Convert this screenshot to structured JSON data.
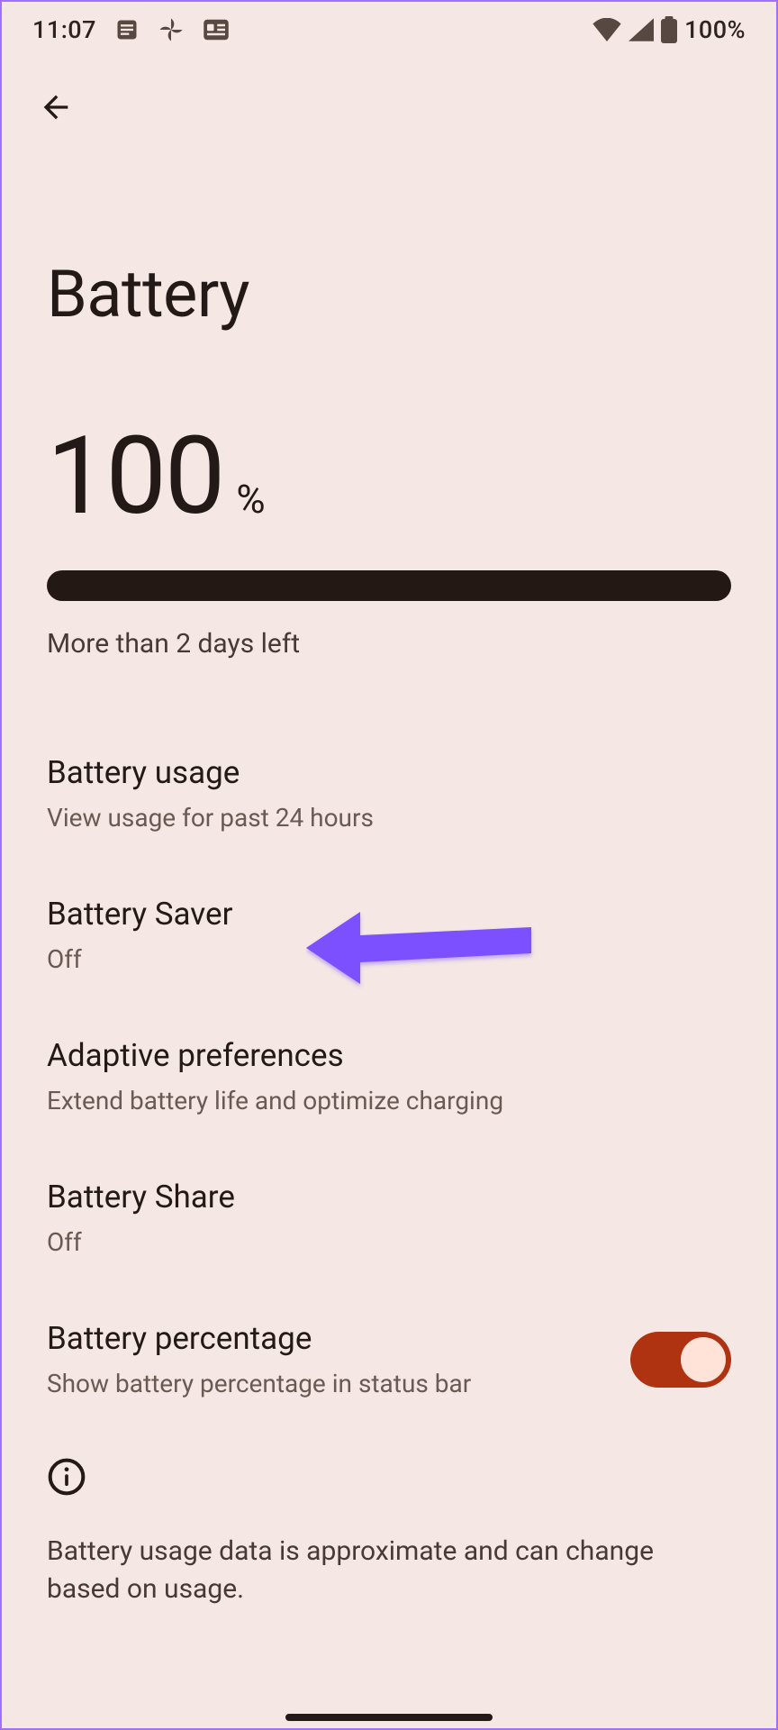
{
  "status": {
    "time": "11:07",
    "battery_pct": "100%"
  },
  "page": {
    "title": "Battery",
    "level_value": "100",
    "level_unit": "%",
    "progress_percent": 100,
    "estimate": "More than 2 days left"
  },
  "prefs": {
    "usage": {
      "title": "Battery usage",
      "sub": "View usage for past 24 hours"
    },
    "saver": {
      "title": "Battery Saver",
      "sub": "Off"
    },
    "adaptive": {
      "title": "Adaptive preferences",
      "sub": "Extend battery life and optimize charging"
    },
    "share": {
      "title": "Battery Share",
      "sub": "Off"
    },
    "percentage": {
      "title": "Battery percentage",
      "sub": "Show battery percentage in status bar",
      "enabled": true
    }
  },
  "info_text": "Battery usage data is approximate and can change based on usage.",
  "annotation_target": "saver"
}
